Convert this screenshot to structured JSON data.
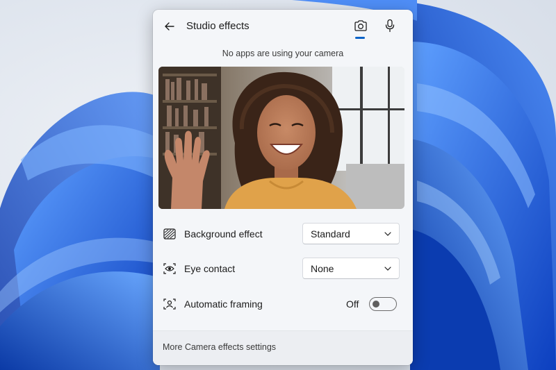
{
  "flyout": {
    "title": "Studio effects",
    "back_icon": "arrow-left-icon",
    "tabs": [
      {
        "name": "camera",
        "icon": "camera-icon",
        "selected": true
      },
      {
        "name": "microphone",
        "icon": "microphone-icon",
        "selected": false
      }
    ],
    "status_text": "No apps are using your camera",
    "preview_image": "camera-preview: smiling woman with curly hair waving",
    "settings": {
      "background_effect": {
        "label": "Background effect",
        "icon": "background-blur-icon",
        "value": "Standard"
      },
      "eye_contact": {
        "label": "Eye contact",
        "icon": "eye-contact-icon",
        "value": "None"
      },
      "automatic_framing": {
        "label": "Automatic framing",
        "icon": "framing-icon",
        "state": "Off",
        "enabled": false
      }
    },
    "footer_link": "More Camera effects settings"
  },
  "colors": {
    "accent": "#0a63c8",
    "flyout_bg": "#f4f6f9",
    "wallpaper_blue": "#1f5fe0"
  }
}
